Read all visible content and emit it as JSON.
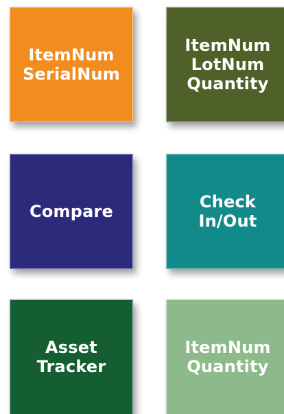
{
  "tiles": [
    {
      "label": "ItemNum\nSerialNum",
      "color": "#F28C1E"
    },
    {
      "label": "ItemNum\nLotNum\nQuantity",
      "color": "#4F6128"
    },
    {
      "label": "Compare",
      "color": "#2C2A7A"
    },
    {
      "label": "Check\nIn/Out",
      "color": "#138A8A"
    },
    {
      "label": "Asset\nTracker",
      "color": "#155E32"
    },
    {
      "label": "ItemNum\nQuantity",
      "color": "#8DBA8A"
    }
  ]
}
